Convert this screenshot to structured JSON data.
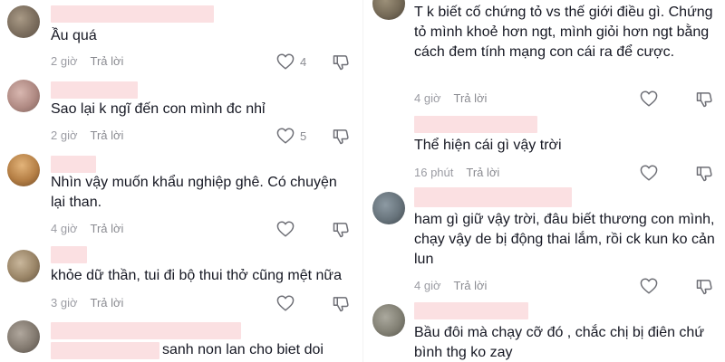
{
  "left_comments": [
    {
      "text": "Ầu quá",
      "time": "2 giờ",
      "reply": "Trả lời",
      "likes": "4"
    },
    {
      "text": "Sao lại k ngĩ đến con mình đc nhỉ",
      "time": "2 giờ",
      "reply": "Trả lời",
      "likes": "5"
    },
    {
      "text": "Nhìn vậy muốn khẩu nghiệp ghê. Có chuyện lại than.",
      "time": "4 giờ",
      "reply": "Trả lời",
      "likes": ""
    },
    {
      "text": "khỏe dữ thần, tui đi bộ thui thở cũng mệt nữa",
      "time": "3 giờ",
      "reply": "Trả lời",
      "likes": ""
    },
    {
      "text": "sanh non lan cho biet doi",
      "time": "",
      "reply": "",
      "likes": ""
    }
  ],
  "right_comments": [
    {
      "text": "T k biết cố chứng tỏ vs thế giới điều gì. Chứng tỏ mình khoẻ hơn ngt, mình giỏi hơn ngt bằng cách đem tính mạng con cái ra để cược.",
      "time": "4 giờ",
      "reply": "Trả lời",
      "likes": ""
    },
    {
      "text": "Thể hiện cái gì vậy trời",
      "time": "16 phút",
      "reply": "Trả lời",
      "likes": ""
    },
    {
      "text": "ham gì giữ vậy trời, đâu biết thương con mình, chạy vậy de bị động thai lắm, rồi ck kun ko cản lun",
      "time": "4 giờ",
      "reply": "Trả lời",
      "likes": ""
    },
    {
      "text": "Bầu đôi mà chạy cỡ đó , chắc chị bị điên chứ bình thg ko zay",
      "time": "",
      "reply": "",
      "likes": ""
    }
  ],
  "icons": {
    "like": "heart-icon",
    "dislike": "thumbs-down-icon"
  }
}
